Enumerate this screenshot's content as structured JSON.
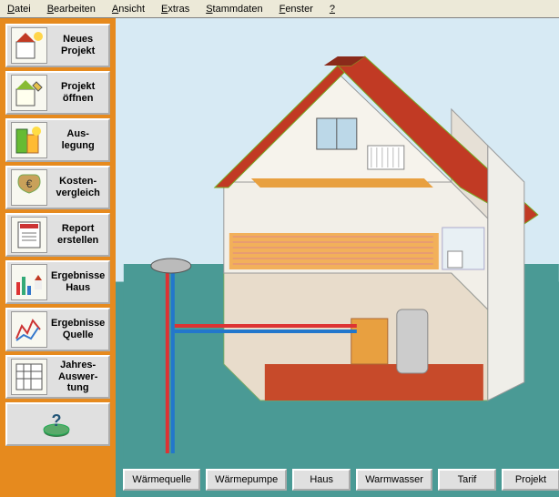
{
  "menu": {
    "items": [
      {
        "label": "Datei",
        "mn": "D"
      },
      {
        "label": "Bearbeiten",
        "mn": "B"
      },
      {
        "label": "Ansicht",
        "mn": "A"
      },
      {
        "label": "Extras",
        "mn": "E"
      },
      {
        "label": "Stammdaten",
        "mn": "S"
      },
      {
        "label": "Fenster",
        "mn": "F"
      },
      {
        "label": "?",
        "mn": "?"
      }
    ]
  },
  "sidebar": {
    "items": [
      {
        "label": "Neues\nProjekt",
        "icon": "new-project-icon"
      },
      {
        "label": "Projekt\nöffnen",
        "icon": "open-project-icon"
      },
      {
        "label": "Aus-\nlegung",
        "icon": "design-icon"
      },
      {
        "label": "Kosten-\nvergleich",
        "icon": "cost-compare-icon"
      },
      {
        "label": "Report\nerstellen",
        "icon": "report-icon"
      },
      {
        "label": "Ergebnisse\nHaus",
        "icon": "results-house-icon"
      },
      {
        "label": "Ergebnisse\nQuelle",
        "icon": "results-source-icon"
      },
      {
        "label": "Jahres-\nAuswer-\ntung",
        "icon": "annual-eval-icon"
      },
      {
        "label": "",
        "icon": "help-icon"
      }
    ]
  },
  "bottom": {
    "buttons": [
      "Wärmequelle",
      "Wärmepumpe",
      "Haus",
      "Warmwasser",
      "Tarif",
      "Projekt"
    ]
  },
  "colors": {
    "accent": "#e68a1e",
    "sky": "#d7eaf4",
    "ground": "#4a9a95",
    "roof": "#c13a24",
    "wall": "#efeee9"
  }
}
